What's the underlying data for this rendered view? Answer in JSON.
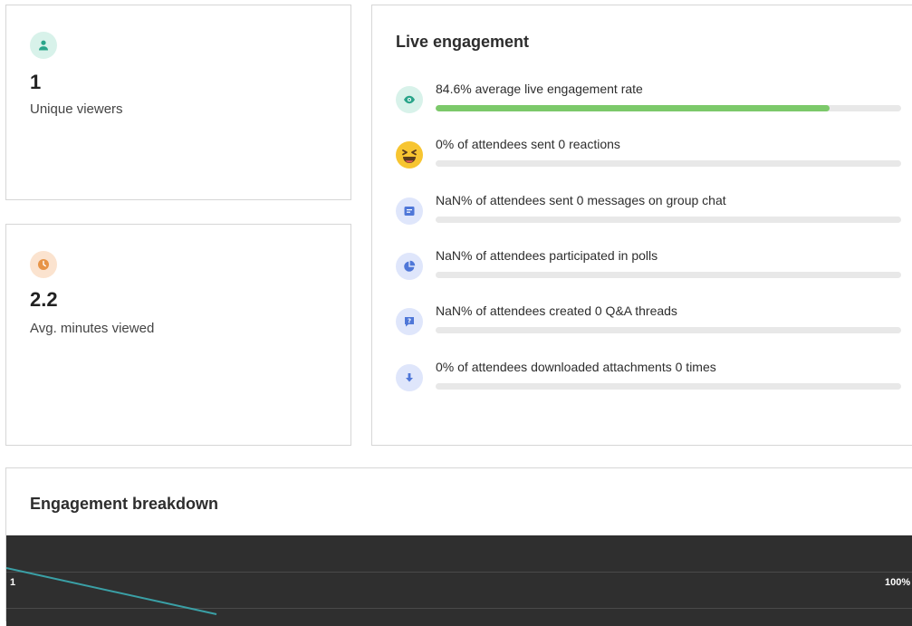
{
  "stats": [
    {
      "value": "1",
      "label": "Unique viewers",
      "icon": "person-icon",
      "icon_bg": "#d8f2ea",
      "icon_color": "#2aa58a"
    },
    {
      "value": "2.2",
      "label": "Avg. minutes viewed",
      "icon": "clock-icon",
      "icon_bg": "#fbe3cf",
      "icon_color": "#e79447"
    }
  ],
  "live_engagement": {
    "title": "Live engagement",
    "metrics": [
      {
        "text": "84.6% average live engagement rate",
        "progress": 0.846,
        "icon": "eye-icon"
      },
      {
        "text": "0% of attendees sent 0 reactions",
        "progress": 0,
        "icon": "laughing-emoji-icon"
      },
      {
        "text": "NaN% of attendees sent 0 messages on group chat",
        "progress": 0,
        "icon": "chat-icon"
      },
      {
        "text": "NaN% of attendees participated in polls",
        "progress": 0,
        "icon": "pie-chart-icon"
      },
      {
        "text": "NaN% of attendees created 0 Q&A threads",
        "progress": 0,
        "icon": "question-icon"
      },
      {
        "text": "0% of attendees downloaded attachments 0 times",
        "progress": 0,
        "icon": "download-icon"
      }
    ]
  },
  "breakdown": {
    "title": "Engagement breakdown",
    "left_tick": "1",
    "right_tick": "100%"
  },
  "colors": {
    "progress_fill": "#7cc96a",
    "progress_track": "#e8e8e8",
    "chart_bg": "#2f2f2f",
    "chart_line": "#3aa0a6"
  }
}
